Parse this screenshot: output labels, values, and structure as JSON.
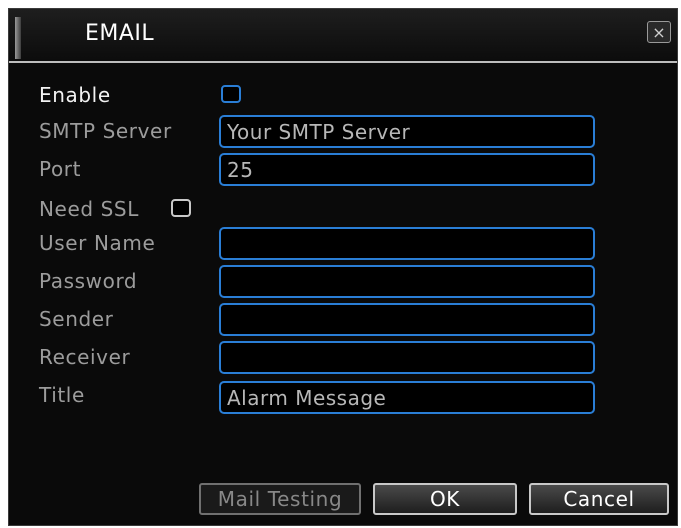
{
  "window": {
    "title": "EMAIL",
    "close_glyph": "×"
  },
  "form": {
    "enable_label": "Enable",
    "enable_checked": false,
    "smtp_server_label": "SMTP Server",
    "smtp_server_value": "Your SMTP Server",
    "port_label": "Port",
    "port_value": "25",
    "need_ssl_label": "Need SSL",
    "need_ssl_checked": false,
    "user_name_label": "User Name",
    "user_name_value": "",
    "password_label": "Password",
    "password_value": "",
    "sender_label": "Sender",
    "sender_value": "",
    "receiver_label": "Receiver",
    "receiver_value": "",
    "title_label": "Title",
    "title_value": "Alarm Message"
  },
  "buttons": {
    "mail_testing": "Mail Testing",
    "ok": "OK",
    "cancel": "Cancel"
  },
  "colors": {
    "field_border": "#2a7ed6",
    "background": "#0a0a0a",
    "active_text": "#f2f2f2",
    "inactive_text": "#9c9c9c"
  }
}
